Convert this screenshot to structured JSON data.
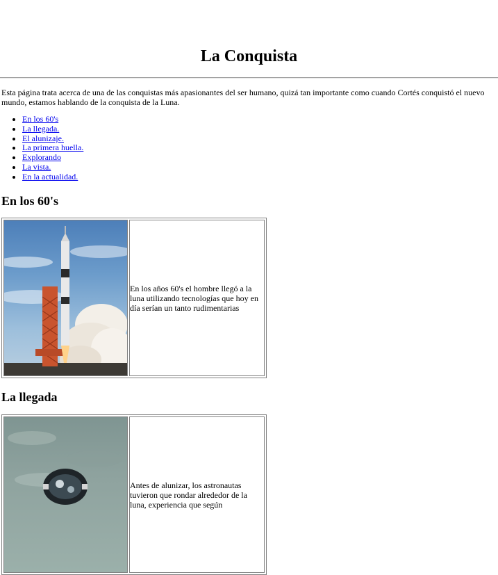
{
  "page": {
    "title": "La Conquista",
    "intro": "Esta página trata acerca de una de las conquistas más apasionantes del ser humano, quizá tan importante como cuando Cortés conquistó el nuevo mundo, estamos hablando de la conquista de la Luna."
  },
  "toc": [
    {
      "label": "En los 60's"
    },
    {
      "label": "La llegada."
    },
    {
      "label": "El alunizaje."
    },
    {
      "label": "La primera huella."
    },
    {
      "label": "Explorando"
    },
    {
      "label": "La vista."
    },
    {
      "label": "En la actualidad."
    }
  ],
  "sections": [
    {
      "heading": "En los 60's",
      "image": "rocket-launch-photo",
      "text": "En los años 60's el hombre llegó a la luna utilizando tecnologías que hoy en día serían un tanto rudimentarias"
    },
    {
      "heading": "La llegada",
      "image": "spacecraft-in-orbit-photo",
      "text": "Antes de alunizar, los astronautas tuvieron que rondar alrededor de la luna, experiencia que según"
    }
  ],
  "colors": {
    "link": "#0000ee",
    "border": "#808080"
  }
}
